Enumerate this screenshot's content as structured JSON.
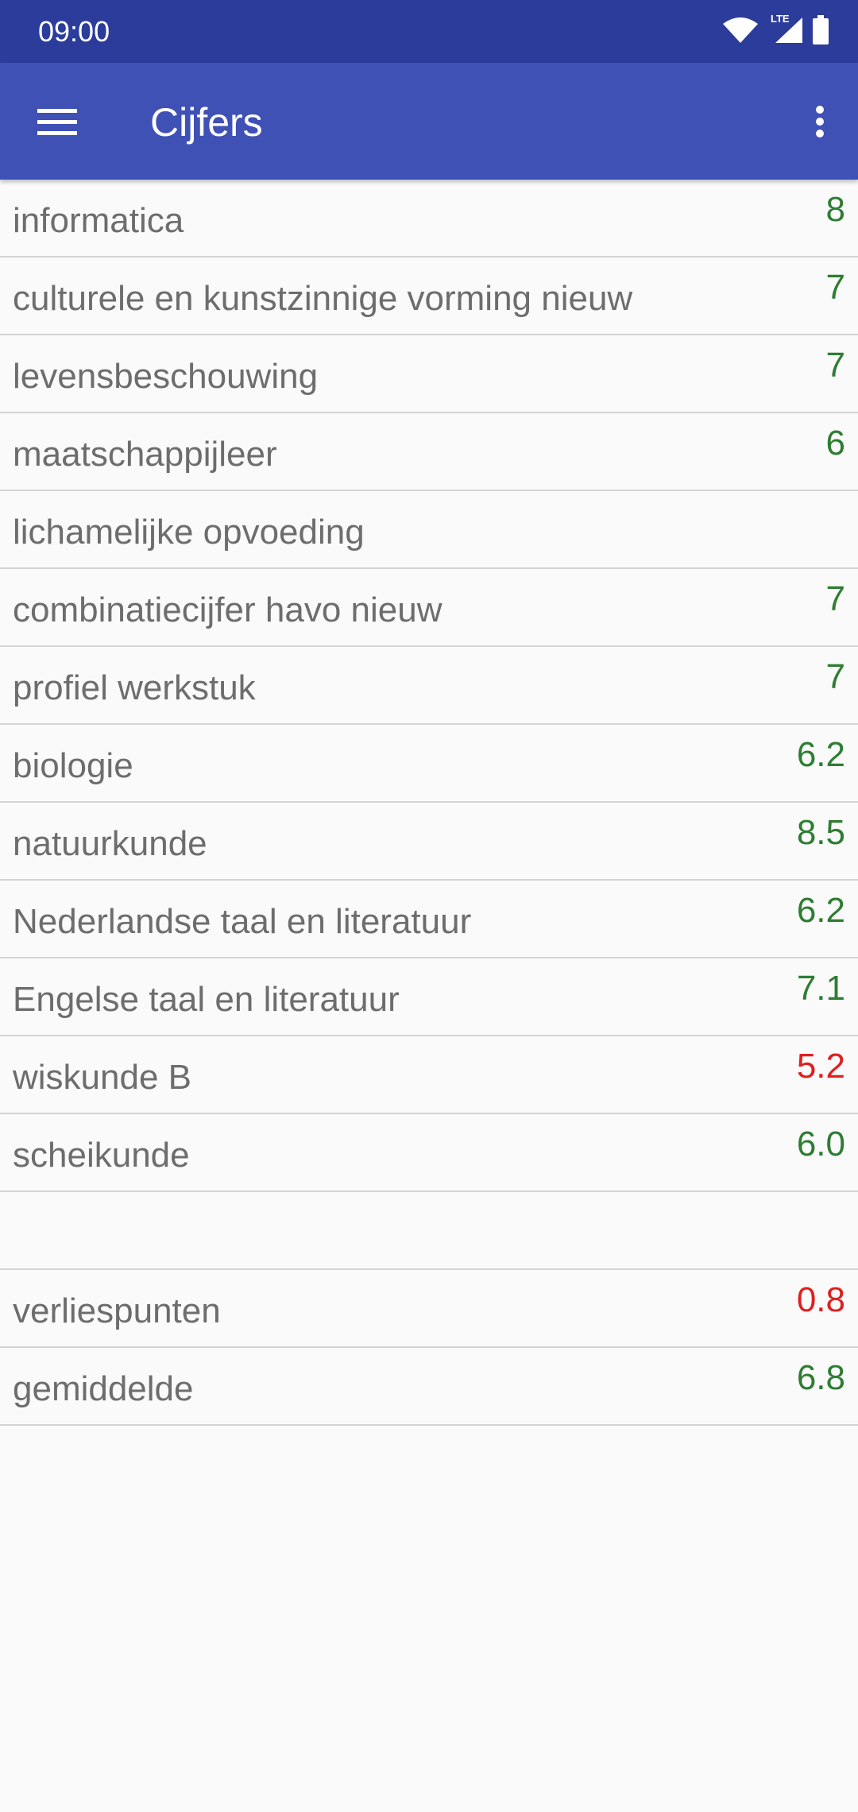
{
  "status_bar": {
    "time": "09:00",
    "network": "LTE"
  },
  "app_bar": {
    "title": "Cijfers"
  },
  "colors": {
    "primary": "#3f51b5",
    "primary_dark": "#2c3c9b",
    "pass": "#2e7d32",
    "fail": "#e01f1f"
  },
  "rows": [
    {
      "subject": "informatica",
      "grade": "8",
      "status": "pass"
    },
    {
      "subject": "culturele en kunstzinnige vorming nieuw",
      "grade": "7",
      "status": "pass"
    },
    {
      "subject": "levensbeschouwing",
      "grade": "7",
      "status": "pass"
    },
    {
      "subject": "maatschappijleer",
      "grade": "6",
      "status": "pass"
    },
    {
      "subject": "lichamelijke opvoeding",
      "grade": "",
      "status": "pass"
    },
    {
      "subject": "combinatiecijfer havo nieuw",
      "grade": "7",
      "status": "pass"
    },
    {
      "subject": "profiel werkstuk",
      "grade": "7",
      "status": "pass"
    },
    {
      "subject": "biologie",
      "grade": "6.2",
      "status": "pass"
    },
    {
      "subject": "natuurkunde",
      "grade": "8.5",
      "status": "pass"
    },
    {
      "subject": "Nederlandse taal en literatuur",
      "grade": "6.2",
      "status": "pass"
    },
    {
      "subject": "Engelse taal en literatuur",
      "grade": "7.1",
      "status": "pass"
    },
    {
      "subject": "wiskunde B",
      "grade": "5.2",
      "status": "fail"
    },
    {
      "subject": "scheikunde",
      "grade": "6.0",
      "status": "pass"
    },
    {
      "subject": "",
      "grade": "",
      "status": "pass"
    },
    {
      "subject": "verliespunten",
      "grade": "0.8",
      "status": "fail"
    },
    {
      "subject": "gemiddelde",
      "grade": "6.8",
      "status": "pass"
    }
  ]
}
